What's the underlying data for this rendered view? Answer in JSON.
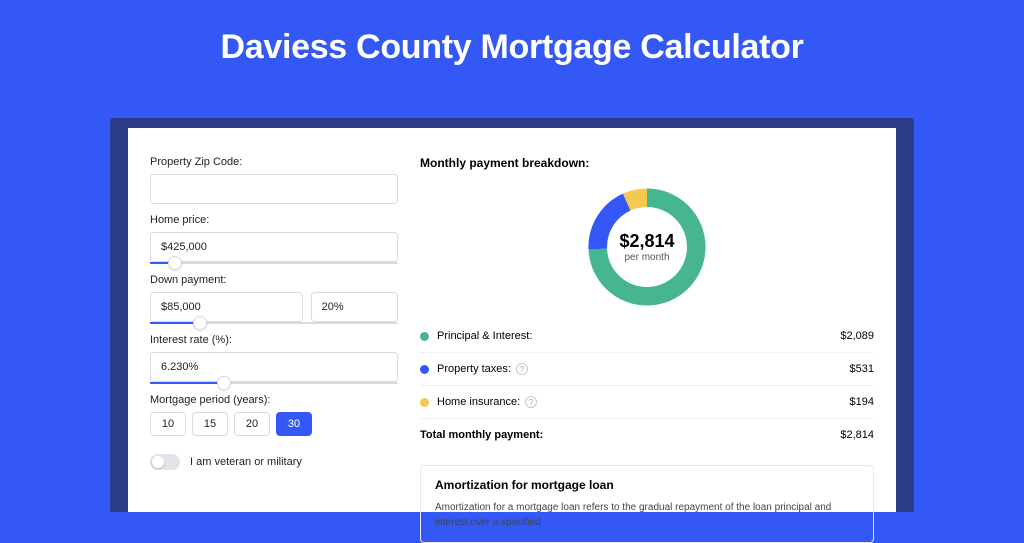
{
  "title": "Daviess County Mortgage Calculator",
  "left": {
    "zip_label": "Property Zip Code:",
    "zip_value": "",
    "home_price_label": "Home price:",
    "home_price_value": "$425,000",
    "home_price_slider_pct": 10,
    "down_payment_label": "Down payment:",
    "down_payment_value": "$85,000",
    "down_payment_pct_value": "20%",
    "down_payment_slider_pct": 20,
    "interest_label": "Interest rate (%):",
    "interest_value": "6.230%",
    "interest_slider_pct": 30,
    "period_label": "Mortgage period (years):",
    "periods": [
      "10",
      "15",
      "20",
      "30"
    ],
    "period_selected": "30",
    "veteran_label": "I am veteran or military"
  },
  "right": {
    "breakdown_title": "Monthly payment breakdown:",
    "donut_total": "$2,814",
    "donut_sub": "per month",
    "items": [
      {
        "label": "Principal & Interest:",
        "value": "$2,089",
        "color": "#46b690",
        "help": false
      },
      {
        "label": "Property taxes:",
        "value": "$531",
        "color": "#3458f5",
        "help": true
      },
      {
        "label": "Home insurance:",
        "value": "$194",
        "color": "#f3ca4f",
        "help": true
      }
    ],
    "total_label": "Total monthly payment:",
    "total_value": "$2,814",
    "amort_title": "Amortization for mortgage loan",
    "amort_text": "Amortization for a mortgage loan refers to the gradual repayment of the loan principal and interest over a specified"
  },
  "chart_data": {
    "type": "pie",
    "title": "Monthly payment breakdown",
    "series": [
      {
        "name": "Principal & Interest",
        "value": 2089,
        "color": "#46b690"
      },
      {
        "name": "Property taxes",
        "value": 531,
        "color": "#3458f5"
      },
      {
        "name": "Home insurance",
        "value": 194,
        "color": "#f3ca4f"
      }
    ],
    "total": 2814,
    "unit": "USD per month"
  }
}
